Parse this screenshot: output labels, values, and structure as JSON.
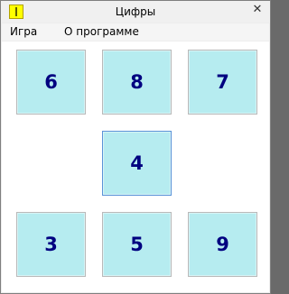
{
  "window": {
    "title": "Цифры"
  },
  "menu": {
    "items": [
      "Игра",
      "О программе"
    ]
  },
  "grid": {
    "cells": [
      "6",
      "8",
      "7",
      "4",
      "3",
      "5",
      "9"
    ]
  },
  "colors": {
    "cell_bg": "#b6ecf0",
    "digit": "#000080",
    "focus_border": "#5a93d8"
  }
}
